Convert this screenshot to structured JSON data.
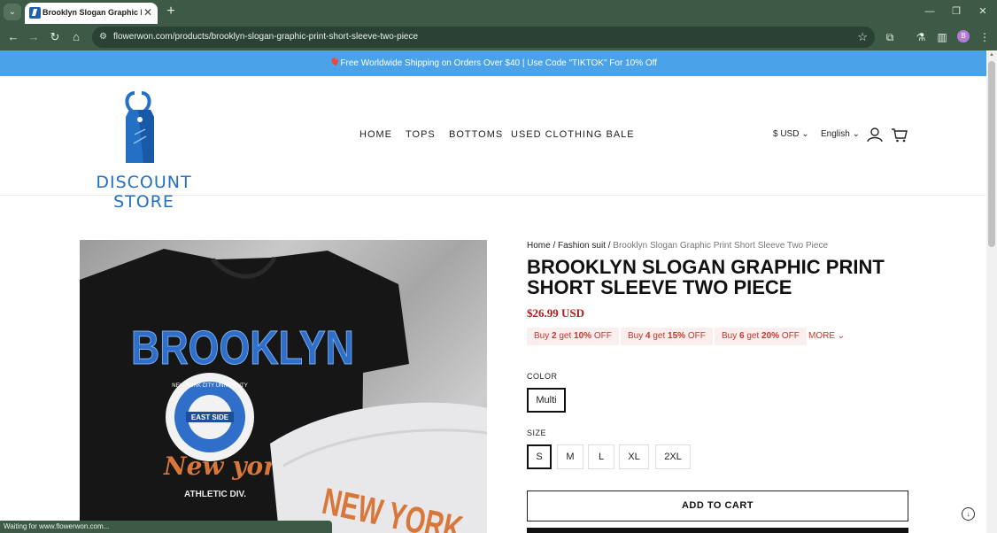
{
  "browser": {
    "tab_title": "Brooklyn Slogan Graphic Print",
    "url": "flowerwon.com/products/brooklyn-slogan-graphic-print-short-sleeve-two-piece",
    "profile_initial": "B",
    "status_text": "Waiting for www.flowerwon.com..."
  },
  "announcement": "🎈Free Worldwide Shipping on Orders Over $40 | Use Code \"TIKTOK\" For 10% Off",
  "logo": {
    "text": "DISCOUNT STORE",
    "color": "#2470c4"
  },
  "nav": {
    "items": [
      "HOME",
      "TOPS",
      "BOTTOMS",
      "USED CLOTHING BALE"
    ]
  },
  "header_right": {
    "currency": "$ USD",
    "language": "English"
  },
  "breadcrumb": {
    "home": "Home",
    "sep": "/",
    "category": "Fashion suit",
    "current": "Brooklyn Slogan Graphic Print Short Sleeve Two Piece"
  },
  "product": {
    "title": "BROOKLYN SLOGAN GRAPHIC PRINT SHORT SLEEVE TWO PIECE",
    "price": "$26.99 USD",
    "offers": [
      {
        "pre": "Buy ",
        "qty": "2",
        "mid": " get ",
        "pct": "10%",
        "post": " OFF"
      },
      {
        "pre": "Buy ",
        "qty": "4",
        "mid": " get ",
        "pct": "15%",
        "post": " OFF"
      },
      {
        "pre": "Buy ",
        "qty": "6",
        "mid": " get ",
        "pct": "20%",
        "post": " OFF"
      }
    ],
    "more_label": "MORE",
    "color_label": "COLOR",
    "color_selected": "Multi",
    "size_label": "SIZE",
    "sizes": [
      "S",
      "M",
      "L",
      "XL",
      "2XL"
    ],
    "size_selected": "S",
    "add_to_cart": "ADD TO CART"
  },
  "image": {
    "shirt_text": "BROOKLYN",
    "badge_ring": "NEW YORK CITY UNIVERSITY",
    "badge_center": "EAST SIDE",
    "script_text": "New york",
    "athletic": "ATHLETIC DIV.",
    "shorts_text": "NEW YORK",
    "colors": {
      "shirt": "#161616",
      "blue": "#2f6fc9",
      "orange": "#d9773a",
      "shorts": "#e8e8ea"
    }
  },
  "colors": {
    "chrome": "#3c5a46",
    "announce_bg": "#4aa3e8",
    "price": "#b11c1c",
    "offer": "#c0392b"
  }
}
